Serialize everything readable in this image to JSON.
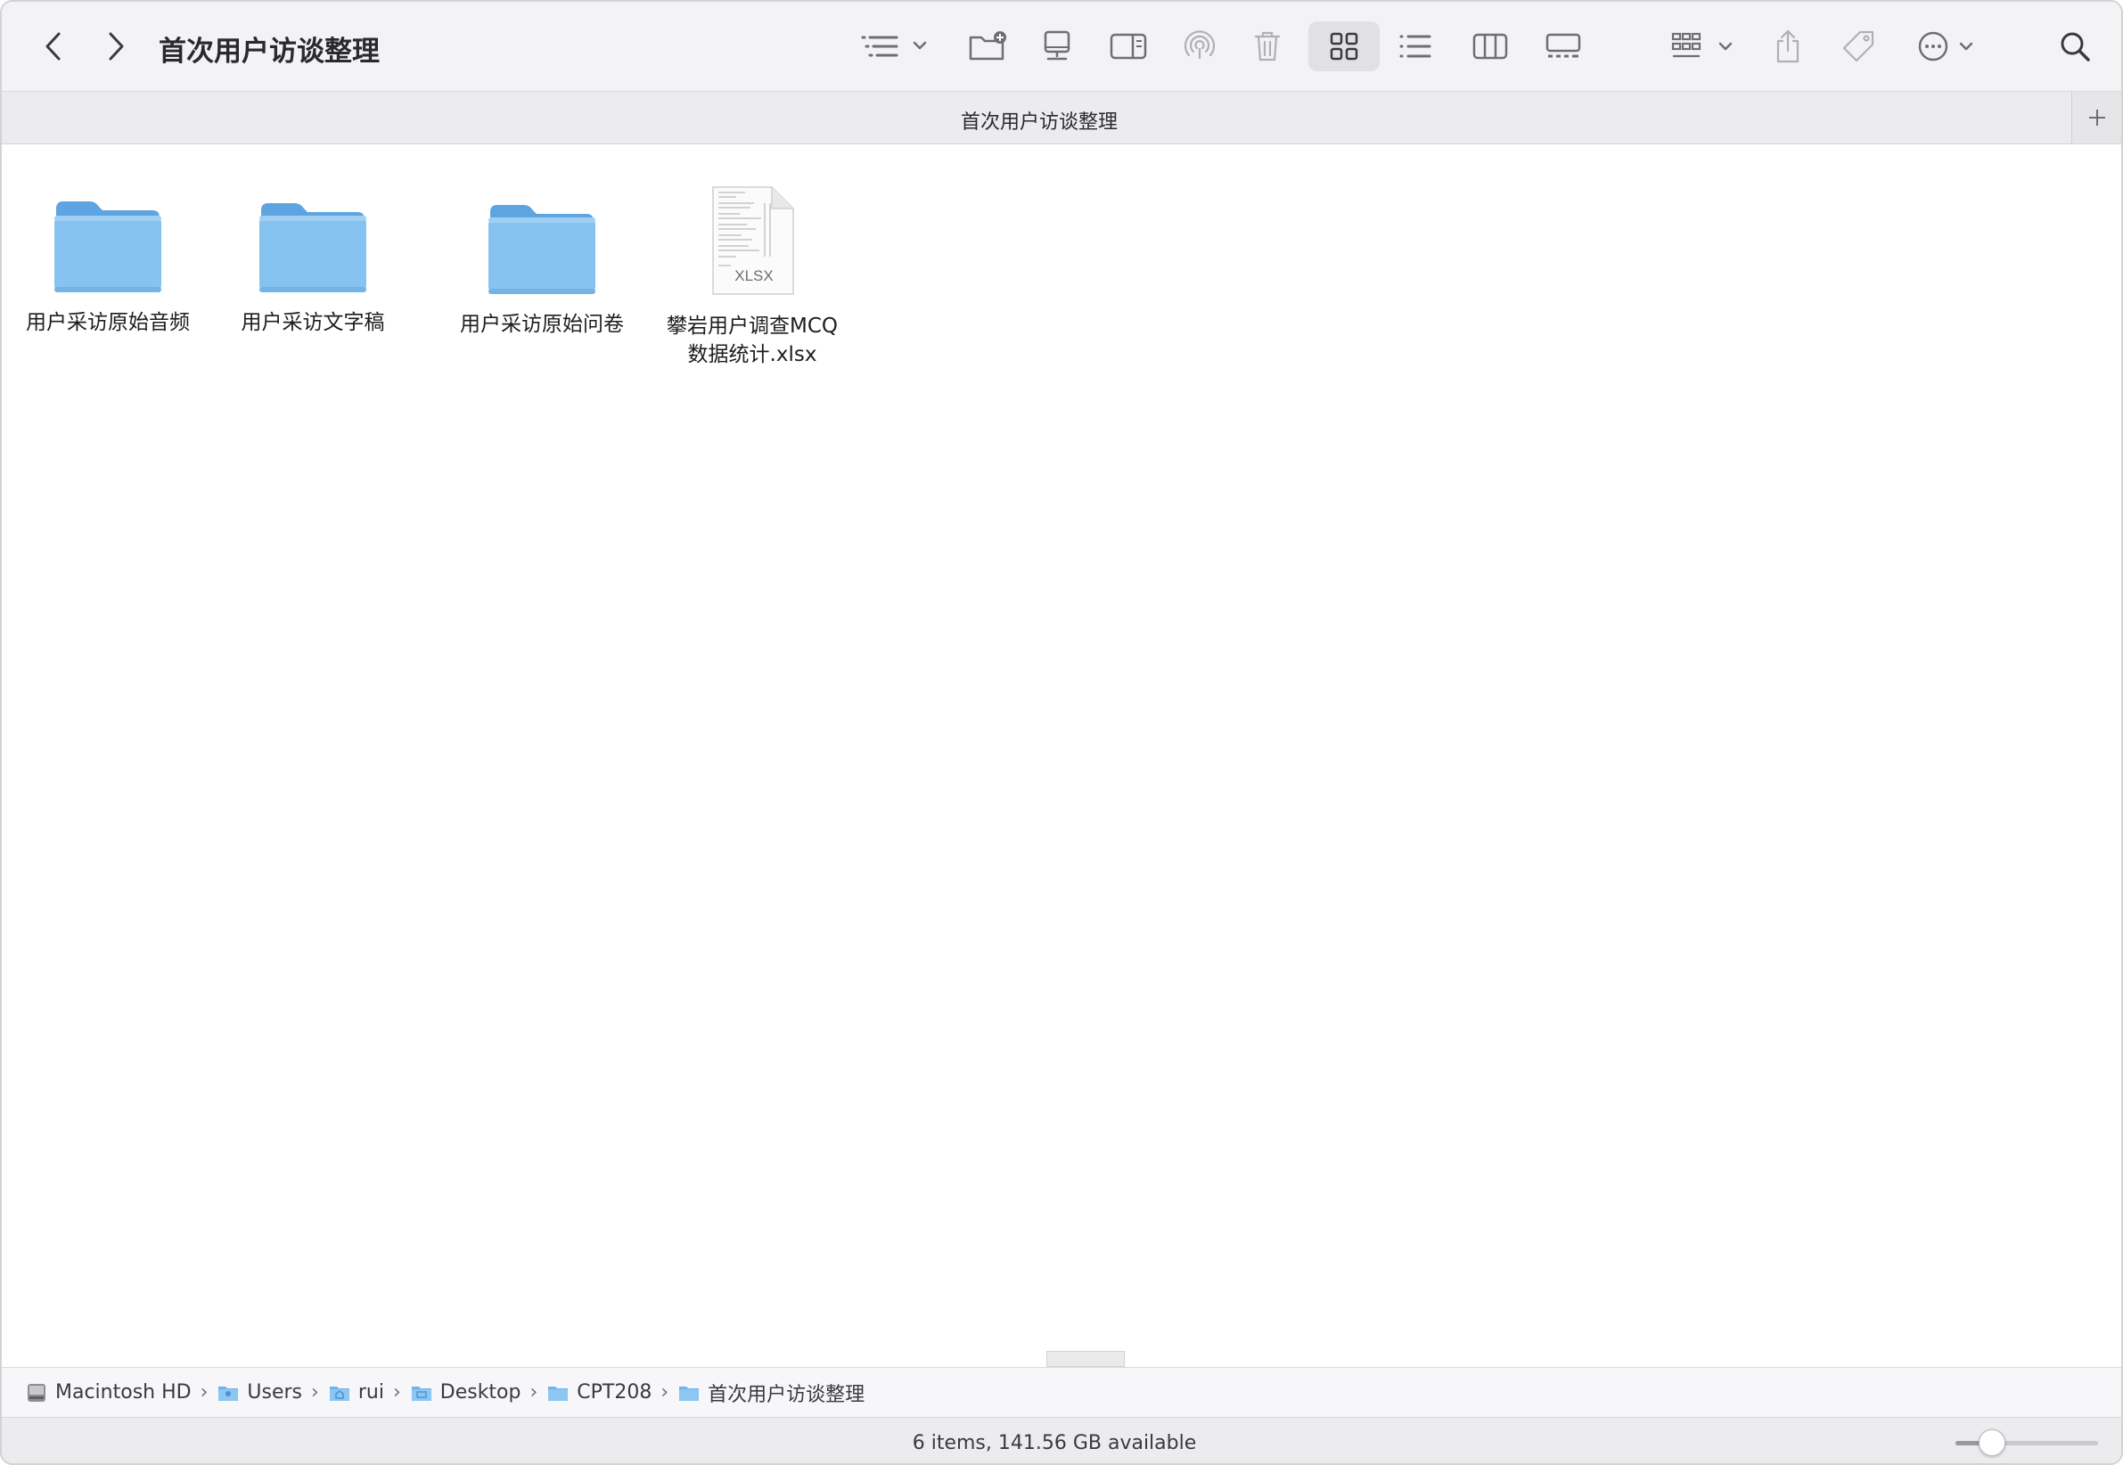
{
  "window": {
    "title": "首次用户访谈整理"
  },
  "toolbar": {
    "icons": [
      "chevron-left-icon",
      "chevron-right-icon",
      "sort-list-icon",
      "new-folder-icon",
      "desktop-icon",
      "preview-pane-icon",
      "airdrop-icon",
      "trash-icon",
      "view-icons-icon",
      "view-list-icon",
      "view-columns-icon",
      "view-gallery-icon",
      "group-icon",
      "share-icon",
      "tag-icon",
      "more-icon",
      "search-icon"
    ],
    "active_view": "icons"
  },
  "tab": {
    "title": "首次用户访谈整理"
  },
  "items": [
    {
      "name": "用户采访原始音频",
      "kind": "folder"
    },
    {
      "name": "用户采访文字稿",
      "kind": "folder"
    },
    {
      "name": "用户采访原始问卷",
      "kind": "folder"
    },
    {
      "name": "攀岩用户调查MCQ数据统计.xlsx",
      "kind": "file",
      "badge": "XLSX",
      "line1": "攀岩用户调查MCQ",
      "line2": "数据统计.xlsx"
    }
  ],
  "pathbar": {
    "crumbs": [
      {
        "label": "Macintosh HD",
        "icon": "hard-drive-icon"
      },
      {
        "label": "Users",
        "icon": "users-folder-icon"
      },
      {
        "label": "rui",
        "icon": "home-folder-icon"
      },
      {
        "label": "Desktop",
        "icon": "desktop-folder-icon"
      },
      {
        "label": "CPT208",
        "icon": "folder-icon"
      },
      {
        "label": "首次用户访谈整理",
        "icon": "folder-icon"
      }
    ]
  },
  "status": {
    "text": "6 items, 141.56 GB available",
    "zoom_level": 0.25
  },
  "colors": {
    "folder_front": "#86c3f0",
    "folder_back": "#5da4e0",
    "toolbar_bg": "#f3f3f5",
    "icon_gray": "#6e6e73"
  }
}
